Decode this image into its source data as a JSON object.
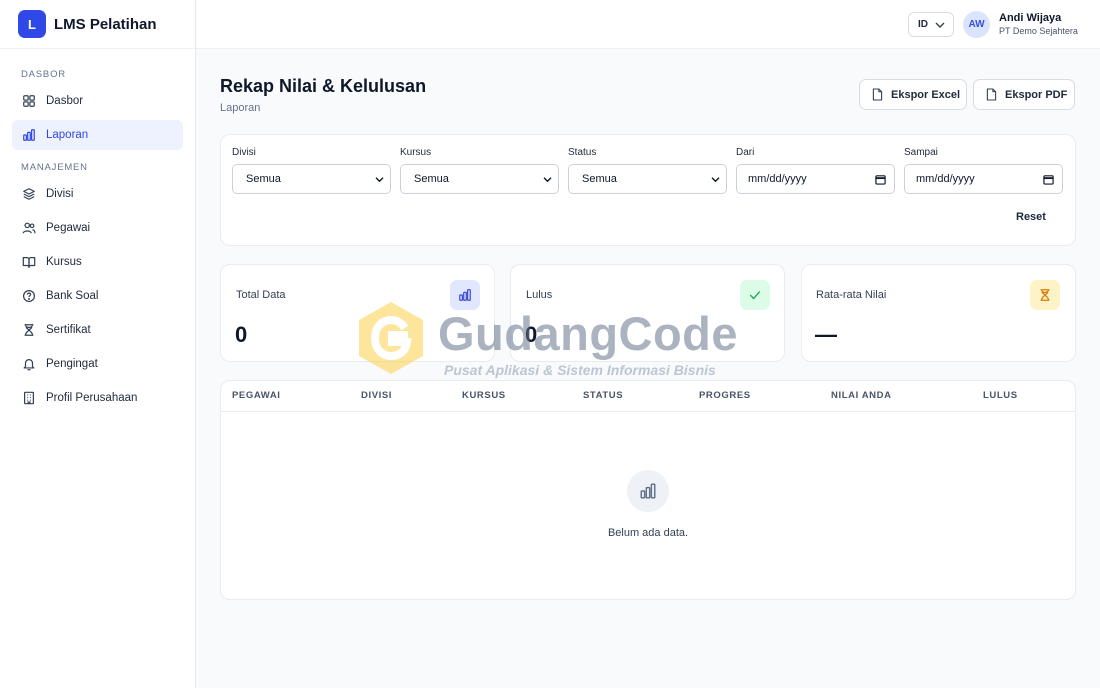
{
  "app": {
    "logo_letter": "L",
    "name": "LMS Pelatihan"
  },
  "sidebar": {
    "sections": [
      {
        "title": "DASBOR",
        "items": [
          {
            "label": "Dasbor",
            "icon": "grid-icon"
          },
          {
            "label": "Laporan",
            "icon": "bar-chart-icon",
            "active": true
          }
        ]
      },
      {
        "title": "MANAJEMEN",
        "items": [
          {
            "label": "Divisi",
            "icon": "layers-icon"
          },
          {
            "label": "Pegawai",
            "icon": "users-icon"
          },
          {
            "label": "Kursus",
            "icon": "book-icon"
          },
          {
            "label": "Bank Soal",
            "icon": "question-circle-icon"
          },
          {
            "label": "Sertifikat",
            "icon": "hourglass-icon"
          },
          {
            "label": "Pengingat",
            "icon": "bell-icon"
          },
          {
            "label": "Profil Perusahaan",
            "icon": "building-icon"
          }
        ]
      }
    ]
  },
  "topbar": {
    "language": "ID",
    "user": {
      "initials": "AW",
      "name": "Andi Wijaya",
      "company": "PT Demo Sejahtera"
    }
  },
  "page": {
    "title": "Rekap Nilai & Kelulusan",
    "breadcrumb": "Laporan",
    "actions": {
      "excel": "Ekspor Excel",
      "pdf": "Ekspor PDF"
    }
  },
  "filters": {
    "divisi": {
      "label": "Divisi",
      "value": "Semua"
    },
    "kursus": {
      "label": "Kursus",
      "value": "Semua"
    },
    "status": {
      "label": "Status",
      "value": "Semua"
    },
    "dari": {
      "label": "Dari",
      "placeholder": "mm/dd/yyyy"
    },
    "sampai": {
      "label": "Sampai",
      "placeholder": "mm/dd/yyyy"
    },
    "reset": "Reset"
  },
  "stats": {
    "total": {
      "label": "Total Data",
      "value": "0",
      "icon": "bar-chart-icon",
      "color": "#e0e7ff"
    },
    "lulus": {
      "label": "Lulus",
      "value": "0",
      "icon": "check-icon",
      "color": "#dcfce7"
    },
    "rata": {
      "label": "Rata-rata Nilai",
      "value": "—",
      "icon": "hourglass-icon",
      "color": "#fef3c7"
    }
  },
  "table": {
    "columns": [
      "PEGAWAI",
      "DIVISI",
      "KURSUS",
      "STATUS",
      "PROGRES",
      "NILAI ANDA",
      "LULUS"
    ],
    "empty_text": "Belum ada data."
  },
  "watermark": {
    "title": "GudangCode",
    "subtitle": "Pusat Aplikasi & Sistem Informasi Bisnis"
  },
  "colors": {
    "primary": "#2f48e8",
    "active_bg": "#eef2ff"
  }
}
